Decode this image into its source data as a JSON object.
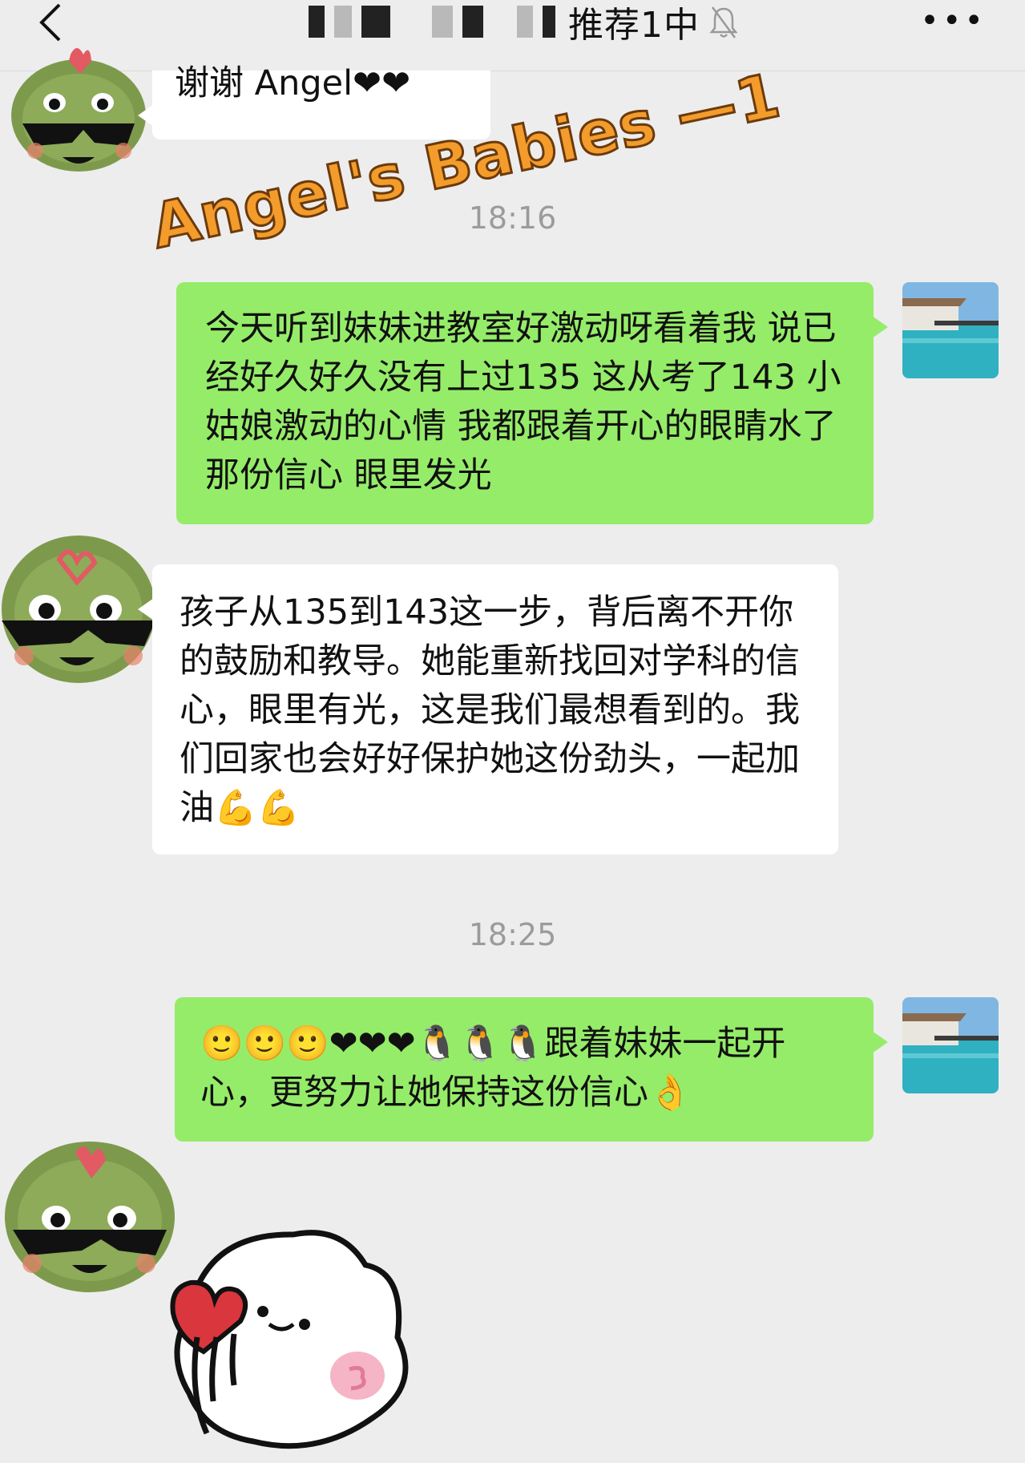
{
  "header": {
    "title": "推荐1中",
    "more_label": "•••"
  },
  "messages": [
    {
      "id": "m1",
      "side": "in",
      "text": "谢谢 Angel❤❤"
    },
    {
      "id": "t1",
      "timestamp": "18:16"
    },
    {
      "id": "m2",
      "side": "out",
      "text": "今天听到妹妹进教室好激动呀看着我 说已经好久好久没有上过135 这从考了143 小姑娘激动的心情 我都跟着开心的眼睛水了 那份信心 眼里发光"
    },
    {
      "id": "m3",
      "side": "in",
      "text": "孩子从135到143这一步，背后离不开你的鼓励和教导。她能重新找回对学科的信心，眼里有光，这是我们最想看到的。我们回家也会好好保护她这份劲头，一起加油💪💪"
    },
    {
      "id": "t2",
      "timestamp": "18:25"
    },
    {
      "id": "m4",
      "side": "out",
      "text": "🙂🙂🙂❤❤❤🐧🐧🐧跟着妹妹一起开心，更努力让她保持这份信心👌"
    }
  ],
  "watermark": "Angel's Babies —1",
  "colors": {
    "bg": "#ededed",
    "outgoing": "#95ec69",
    "incoming": "#ffffff",
    "watermark": "#f39c2c"
  },
  "icons": [
    "back-arrow-icon",
    "mute-bell-icon",
    "more-dots-icon",
    "frog-sunglasses-avatar",
    "beach-villa-avatar",
    "heart-sticker"
  ]
}
